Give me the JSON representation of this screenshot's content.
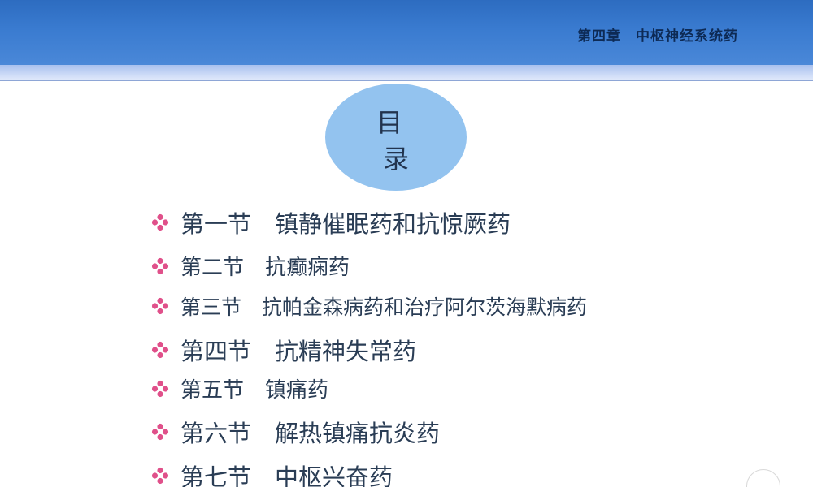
{
  "header": {
    "chapter_title": "第四章　中枢神经系统药"
  },
  "toc_heading": {
    "char_1": "目",
    "char_2": "录"
  },
  "colors": {
    "header_blue": "#3a7bd0",
    "ellipse_blue": "#93c3ef",
    "bullet_pink": "#e0508a",
    "text_dark": "#2a3d55"
  },
  "toc_items": [
    {
      "label": "第一节　镇静催眠药和抗惊厥药",
      "icon": "diamond-bullet-icon"
    },
    {
      "label": "第二节　抗癫痫药",
      "icon": "diamond-bullet-icon"
    },
    {
      "label": "第三节　抗帕金森病药和治疗阿尔茨海默病药",
      "icon": "diamond-bullet-icon"
    },
    {
      "label": "第四节　抗精神失常药",
      "icon": "diamond-bullet-icon"
    },
    {
      "label": "第五节　镇痛药",
      "icon": "diamond-bullet-icon"
    },
    {
      "label": "第六节　解热镇痛抗炎药",
      "icon": "diamond-bullet-icon"
    },
    {
      "label": "第七节　中枢兴奋药",
      "icon": "diamond-bullet-icon"
    }
  ]
}
